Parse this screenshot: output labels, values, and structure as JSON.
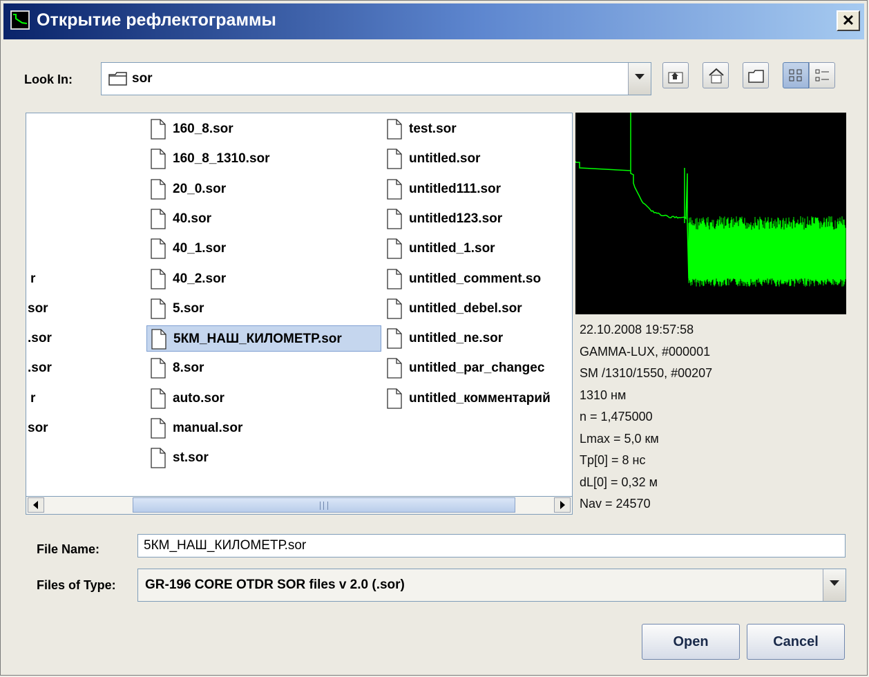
{
  "window": {
    "title": "Открытие рефлектограммы",
    "close_glyph": "✕"
  },
  "look_in": {
    "label": "Look In:",
    "value": "sor"
  },
  "toolbar": {
    "icons": [
      "up-one-level-icon",
      "home-icon",
      "new-folder-icon",
      "list-view-icon",
      "details-view-icon"
    ]
  },
  "files": {
    "col1_fragments": [
      "r",
      "sor",
      ".sor",
      ".sor",
      "r",
      "sor"
    ],
    "col2": [
      "160_8.sor",
      "160_8_1310.sor",
      "20_0.sor",
      "40.sor",
      "40_1.sor",
      "40_2.sor",
      "5.sor",
      "5КМ_НАШ_КИЛОМЕТР.sor",
      "8.sor",
      "auto.sor",
      "manual.sor",
      "st.sor"
    ],
    "col3": [
      "test.sor",
      "untitled.sor",
      "untitled111.sor",
      "untitled123.sor",
      "untitled_1.sor",
      "untitled_comment.so",
      "untitled_debel.sor",
      "untitled_ne.sor",
      "untitled_par_changec",
      "untitled_комментарий"
    ],
    "selected": "5КМ_НАШ_КИЛОМЕТР.sor"
  },
  "preview": {
    "lines": [
      "22.10.2008     19:57:58",
      "GAMMA-LUX, #000001",
      "SM /1310/1550, #00207",
      "1310 нм",
      "n = 1,475000",
      "Lmax = 5,0 км",
      "Tp[0] = 8 нс",
      "dL[0] = 0,32 м",
      "Nav = 24570"
    ],
    "trace_color": "#00ff00"
  },
  "file_name": {
    "label": "File Name:",
    "value": "5КМ_НАШ_КИЛОМЕТР.sor"
  },
  "file_type": {
    "label": "Files of Type:",
    "value": "GR-196 CORE OTDR SOR files v 2.0 (.sor)"
  },
  "buttons": {
    "open": "Open",
    "cancel": "Cancel"
  }
}
